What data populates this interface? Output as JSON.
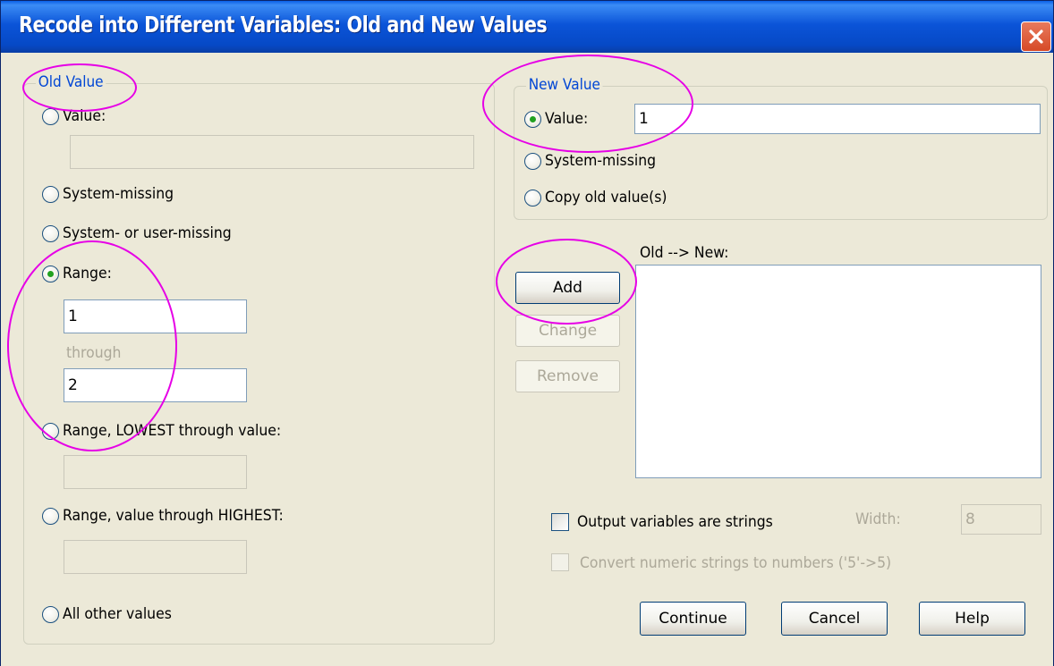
{
  "window": {
    "title": "Recode into Different Variables: Old and New Values"
  },
  "old_value": {
    "legend": "Old Value",
    "value_label": "Value:",
    "value_input": "",
    "system_missing": "System-missing",
    "system_or_user_missing": "System- or user-missing",
    "range_label": "Range:",
    "range_from": "1",
    "through": "through",
    "range_to": "2",
    "lowest_label": "Range, LOWEST through value:",
    "lowest_input": "",
    "highest_label": "Range, value through HIGHEST:",
    "highest_input": "",
    "all_other": "All other values",
    "selected": "Range"
  },
  "new_value": {
    "legend": "New Value",
    "value_label": "Value:",
    "value_input": "1",
    "system_missing": "System-missing",
    "copy_old": "Copy old value(s)",
    "selected": "Value"
  },
  "mapping": {
    "label": "Old --> New:",
    "add": "Add",
    "change": "Change",
    "remove": "Remove",
    "items": []
  },
  "options": {
    "output_strings": "Output variables are strings",
    "output_strings_checked": false,
    "width_label": "Width:",
    "width_value": "8",
    "convert_numeric": "Convert numeric strings to numbers ('5'->5)",
    "convert_numeric_checked": false
  },
  "buttons": {
    "continue": "Continue",
    "cancel": "Cancel",
    "help": "Help"
  },
  "colors": {
    "legend": "#0046d5",
    "annotation": "#e600e6",
    "radio_dot": "#21a121",
    "titlebar": "#0b54d8"
  }
}
